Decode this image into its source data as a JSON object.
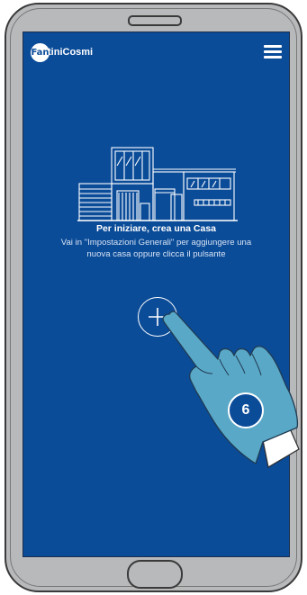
{
  "app": {
    "logo_badge_text": "Fan",
    "logo_text": "tiniCosmi"
  },
  "empty_state": {
    "title": "Per iniziare, crea una Casa",
    "description": "Vai in \"Impostazioni Generali\" per aggiungere una nuova casa oppure clicca il pulsante"
  },
  "tutorial": {
    "step_number": "6"
  },
  "icons": {
    "menu": "hamburger-menu-icon",
    "add": "plus-icon",
    "house": "house-outline-illustration",
    "pointer": "pointing-hand-icon"
  },
  "colors": {
    "screen_background": "#0b4c99",
    "phone_body": "#b8b9bb",
    "hand_fill": "#5aa8c7",
    "white": "#ffffff"
  }
}
